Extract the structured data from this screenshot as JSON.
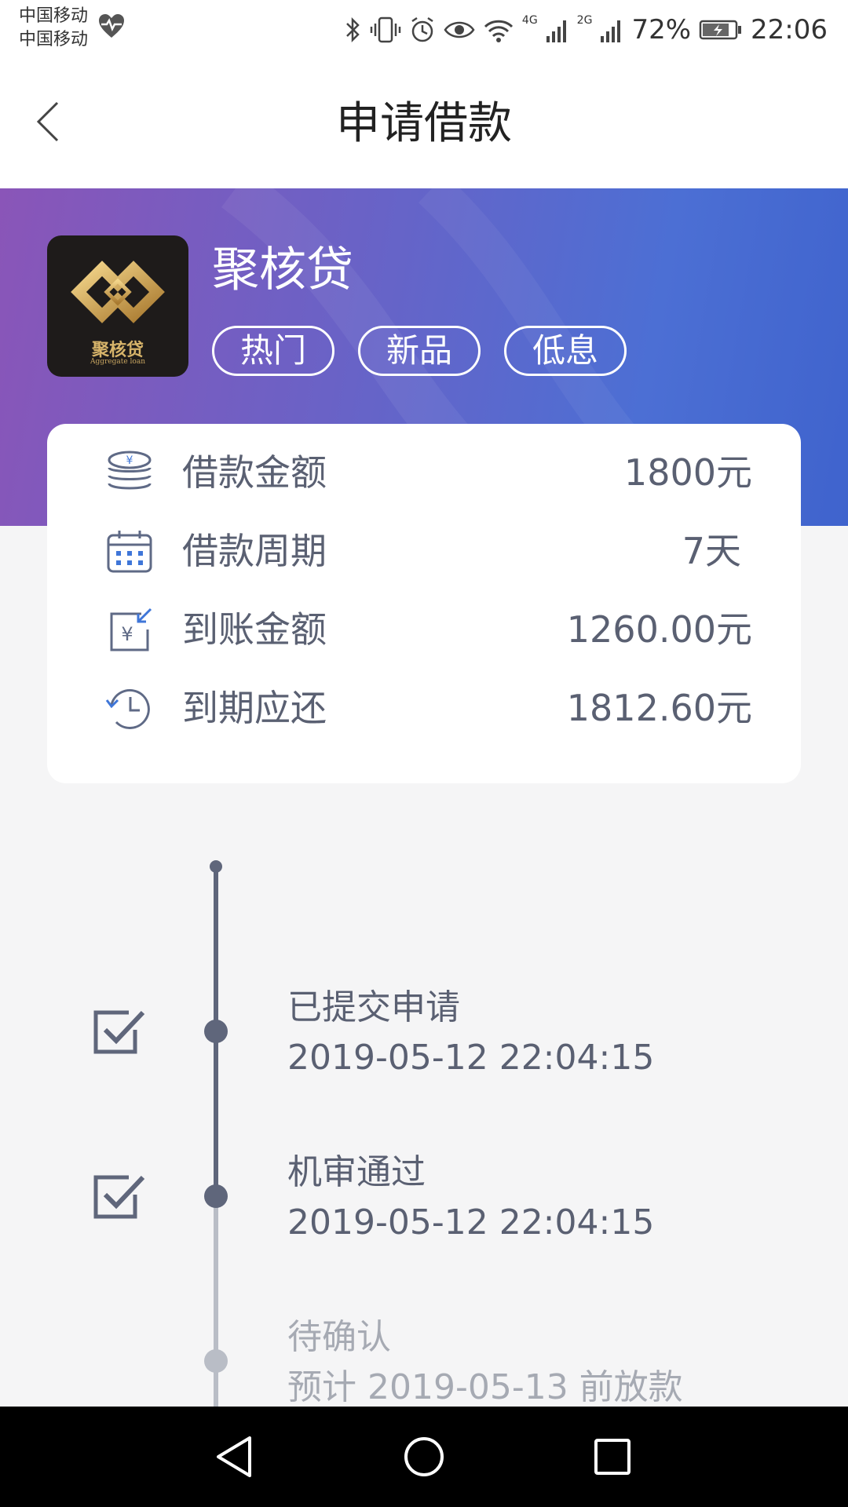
{
  "status_bar": {
    "carrier_1": "中国移动",
    "carrier_2": "中国移动",
    "network_1": "4G",
    "network_2": "2G",
    "battery": "72%",
    "time": "22:06"
  },
  "header": {
    "title": "申请借款"
  },
  "product": {
    "name": "聚核贷",
    "logo_text": "聚核贷",
    "logo_sub": "Aggregate loan",
    "tags": [
      "热门",
      "新品",
      "低息"
    ]
  },
  "info": {
    "rows": [
      {
        "icon": "coins-icon",
        "label": "借款金额",
        "value": "1800元"
      },
      {
        "icon": "calendar-icon",
        "label": "借款周期",
        "value": "7天"
      },
      {
        "icon": "received-money-icon",
        "label": "到账金额",
        "value": "1260.00元"
      },
      {
        "icon": "clock-history-icon",
        "label": "到期应还",
        "value": "1812.60元"
      }
    ]
  },
  "timeline": {
    "steps": [
      {
        "title": "已提交申请",
        "time": "2019-05-12 22:04:15",
        "done": true
      },
      {
        "title": "机审通过",
        "time": "2019-05-12 22:04:15",
        "done": true
      },
      {
        "title": "待确认",
        "time": "预计 2019-05-13 前放款",
        "done": false
      }
    ]
  },
  "colors": {
    "accent": "#5f667b",
    "pending": "#b9bdc6",
    "banner_start": "#8a55b8",
    "banner_end": "#3f63cd"
  }
}
